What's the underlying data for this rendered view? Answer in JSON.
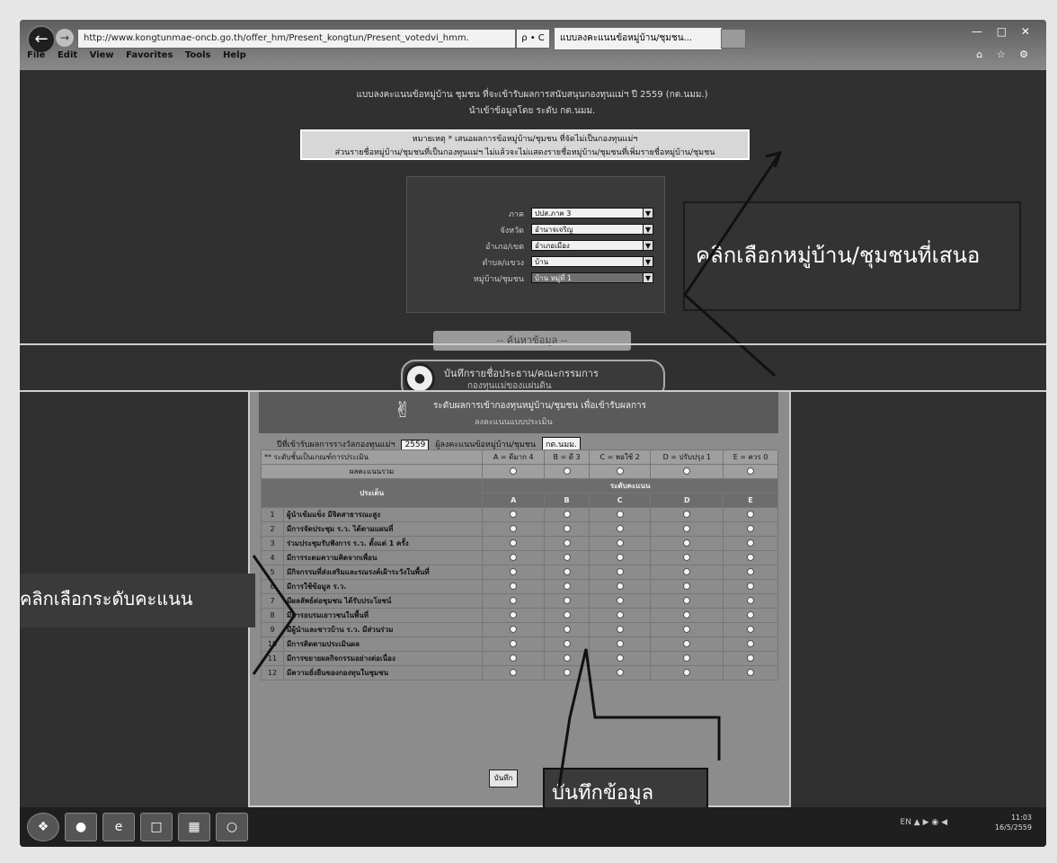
{
  "browser": {
    "address": "http://www.kongtunmae-oncb.go.th/offer_hm/Present_kongtun/Present_votedvi_hmm.",
    "address_icons": "ρ • C",
    "tab_title": "แบบลงคะแนนข้อหมู่บ้าน/ชุมชน...",
    "menu": [
      "File",
      "Edit",
      "View",
      "Favorites",
      "Tools",
      "Help"
    ]
  },
  "page": {
    "heading1": "แบบลงคะแนนข้อหมู่บ้าน ชุมชน ที่จะเข้ารับผลการสนับสนุนกองทุนแม่ฯ ปี 2559 (กต.นมม.)",
    "heading2": "นำเข้าข้อมูลโดย ระดับ กต.นมม.",
    "notice_line1": "หมายเหตุ * เสนอผลการข้อหมู่บ้าน/ชุมชน ที่จัดไม่เป็นกองทุนแม่ฯ",
    "notice_line2": "ส่วนรายชื่อหมู่บ้าน/ชุมชนที่เป็นกองทุนแม่ฯ ไม่แล้วจะไม่แสดงรายชื่อหมู่บ้าน/ชุมชนที่เพิ่มรายชื่อหมู่บ้าน/ชุมชน",
    "form": [
      {
        "label": "ภาค",
        "value": "ปปส.ภาค 3"
      },
      {
        "label": "จังหวัด",
        "value": "อำนาจเจริญ"
      },
      {
        "label": "อำเภอ/เขต",
        "value": "อำเภอเมือง"
      },
      {
        "label": "ตำบล/แขวง",
        "value": "บ้าน"
      },
      {
        "label": "หมู่บ้าน/ชุมชน",
        "value": "บ้าน หมู่ที่ 1"
      }
    ],
    "search_button": "-- ค้นหาข้อมูล --",
    "callout_village": "คลิกเลือกหมู่บ้าน/ชุมชนที่เสนอ",
    "banner_title": "บันทึกรายชื่อประธาน/คณะกรรมการ",
    "banner_subtitle": "กองทุนแม่ของแผ่นดิน"
  },
  "score_window": {
    "title": "ระดับผลการเข้ากองทุนหมู่บ้าน/ชุมชน เพื่อเข้ารับผลการ",
    "subtitle": "ลงคะแนนแบบประเมิน",
    "filter_year_label": "ปีที่เข้ารับผลการรางวัลกองทุนแม่ฯ",
    "filter_year": "2559",
    "filter_level_label": "ผู้ลงคะแนนข้อหมู่บ้าน/ชุมชน",
    "filter_level": "กต.นมม.",
    "legend_header": "** ระดับชั้นเป็นเกณฑ์การประเมิน",
    "grades_header": [
      "A = ดีมาก 4",
      "B = ดี 3",
      "C = พอใช้ 2",
      "D = ปรับปรุง 1",
      "E = ควร 0"
    ],
    "summary_label": "ผลคะแนนรวม",
    "col_topic": "ประเด็น",
    "col_score": "ระดับคะแนน",
    "grade_letters": [
      "A",
      "B",
      "C",
      "D",
      "E"
    ],
    "rows": [
      {
        "no": "1",
        "text": "ผู้นำเข้มแข็ง มีจิตสาธารณะสูง"
      },
      {
        "no": "2",
        "text": "มีการจัดประชุม ร.ว. ได้ตามแผนที่"
      },
      {
        "no": "3",
        "text": "ร่วมประชุมรับฟังการ ร.ว. ตั้งแต่ 1 ครั้ง"
      },
      {
        "no": "4",
        "text": "มีการระดมความคิดจากเพื่อน"
      },
      {
        "no": "5",
        "text": "มีกิจกรรมที่ส่งเสริมและรณรงค์เฝ้าระวังในพื้นที่"
      },
      {
        "no": "6",
        "text": "มีการใช้ข้อมูล ร.ว."
      },
      {
        "no": "7",
        "text": "มีผลลัพธ์ต่อชุมชน ได้รับประโยชน์"
      },
      {
        "no": "8",
        "text": "มีการอบรมเยาวชนในพื้นที่"
      },
      {
        "no": "9",
        "text": "มีผู้นำและชาวบ้าน ร.ว. มีส่วนร่วม"
      },
      {
        "no": "10",
        "text": "มีการติดตามประเมินผล"
      },
      {
        "no": "11",
        "text": "มีการขยายผลกิจกรรมอย่างต่อเนื่อง"
      },
      {
        "no": "12",
        "text": "มีความยั่งยืนของกองทุนในชุมชน"
      }
    ],
    "save_button": "บันทึก"
  },
  "annotations": {
    "score_callout": "คลิกเลือกระดับคะแนน",
    "save_callout": "บันทึกข้อมูล"
  },
  "taskbar": {
    "items": [
      "start-orb",
      "browser-chrome",
      "internet-explorer",
      "file-explorer",
      "calendar-app",
      "chat-app"
    ],
    "tray": "EN  ▲  ▶  ◉  ◀",
    "time": "11:03",
    "date": "16/5/2559"
  }
}
